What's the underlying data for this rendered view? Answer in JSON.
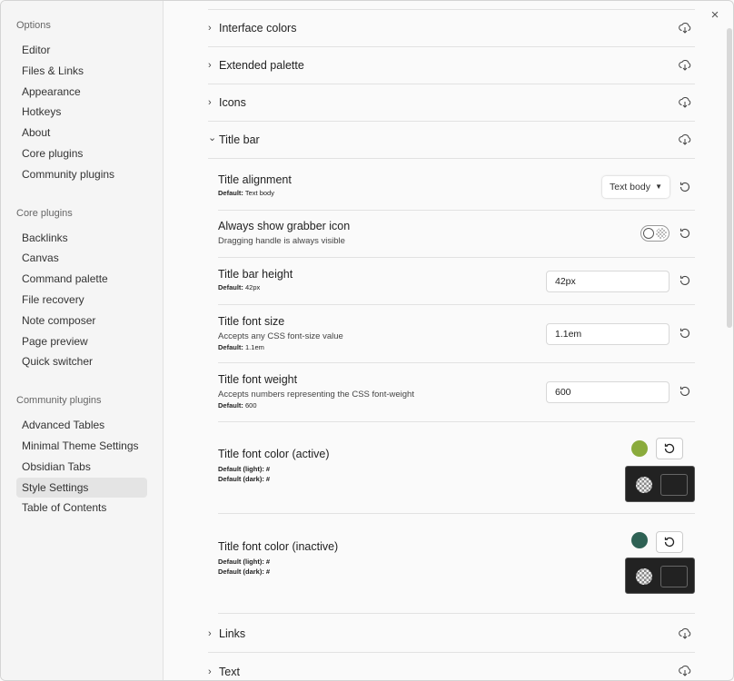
{
  "sidebar": {
    "groups": [
      {
        "title": "Options",
        "items": [
          "Editor",
          "Files & Links",
          "Appearance",
          "Hotkeys",
          "About",
          "Core plugins",
          "Community plugins"
        ]
      },
      {
        "title": "Core plugins",
        "items": [
          "Backlinks",
          "Canvas",
          "Command palette",
          "File recovery",
          "Note composer",
          "Page preview",
          "Quick switcher"
        ]
      },
      {
        "title": "Community plugins",
        "items": [
          "Advanced Tables",
          "Minimal Theme Settings",
          "Obsidian Tabs",
          "Style Settings",
          "Table of Contents"
        ]
      }
    ],
    "active_item": "Style Settings"
  },
  "close_icon": "×",
  "sections_top": [
    "Interface colors",
    "Extended palette",
    "Icons"
  ],
  "title_bar": {
    "label": "Title bar",
    "settings": {
      "alignment": {
        "name": "Title alignment",
        "default_label": "Default:",
        "default_value": "Text body",
        "value": "Text body"
      },
      "grabber": {
        "name": "Always show grabber icon",
        "desc": "Dragging handle is always visible"
      },
      "height": {
        "name": "Title bar height",
        "default_label": "Default:",
        "default_value": "42px",
        "value": "42px"
      },
      "font_size": {
        "name": "Title font size",
        "desc": "Accepts any CSS font-size value",
        "default_label": "Default:",
        "default_value": "1.1em",
        "value": "1.1em"
      },
      "font_weight": {
        "name": "Title font weight",
        "desc": "Accepts numbers representing the CSS font-weight",
        "default_label": "Default:",
        "default_value": "600",
        "value": "600"
      },
      "color_active": {
        "name": "Title font color (active)",
        "default_light": "Default (light): #",
        "default_dark": "Default (dark): #",
        "swatch": "#8aab3c"
      },
      "color_inactive": {
        "name": "Title font color (inactive)",
        "default_light": "Default (light): #",
        "default_dark": "Default (dark): #",
        "swatch": "#2e6154"
      }
    }
  },
  "sections_bottom": [
    "Links",
    "Text"
  ],
  "chevron_right": "›",
  "chevron_down": "⌄",
  "caret": "▼"
}
